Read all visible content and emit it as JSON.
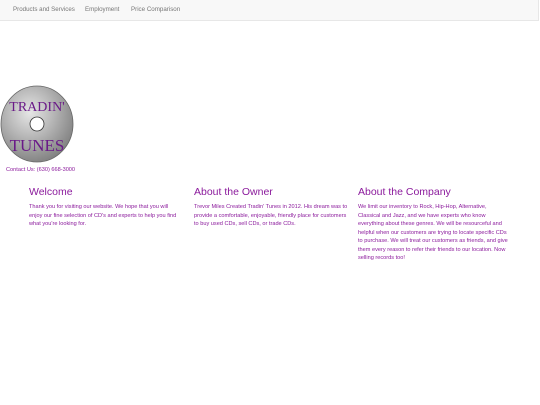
{
  "nav": {
    "items": [
      {
        "label": "Products and Services"
      },
      {
        "label": "Employment"
      },
      {
        "label": "Price Comparison"
      }
    ]
  },
  "logo": {
    "line1": "TRADIN'",
    "line2": "TUNES",
    "text_color": "#6a1a88",
    "disc_color": "#a9a9a9"
  },
  "contact": {
    "text": "Contact Us: (630) 668-3000"
  },
  "sections": {
    "welcome": {
      "title": "Welcome",
      "body": "Thank you for visiting our website. We hope that you will enjoy our fine selection of CD's and experts to help you find what you're looking for."
    },
    "owner": {
      "title": "About the Owner",
      "body": "Trevor Miles Created Tradin' Tunes in 2012. His dream was to provide a comfortable, enjoyable, friendly place for customers to buy used CDs, sell CDs, or trade CDs."
    },
    "company": {
      "title": "About the Company",
      "body": "We limit our inventory to Rock, Hip-Hop, Alternative, Classical and Jazz, and we have experts who know everything about these genres. We will be resourceful and helpful when our customers are trying to locate specific CDs to purchase. We will treat our customers as friends, and give them every reason to refer their friends to our location. Now selling records too!"
    }
  },
  "colors": {
    "accent": "#8b1a9c",
    "nav_text": "#777777",
    "nav_bg": "#f8f8f8"
  }
}
